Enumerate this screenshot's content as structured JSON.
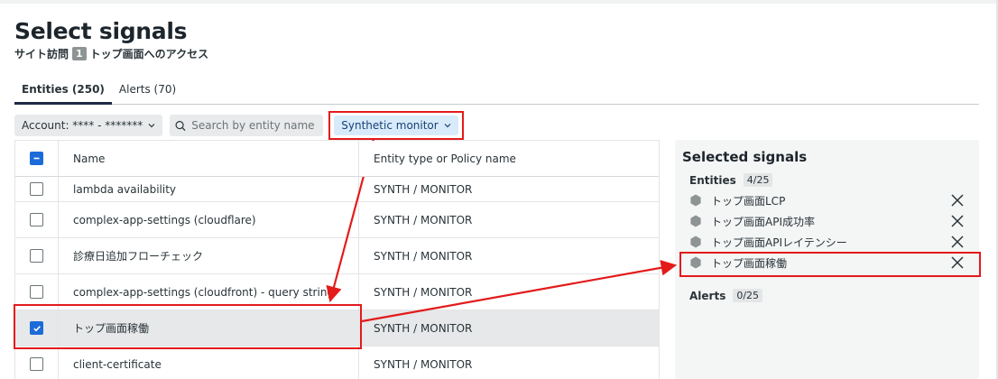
{
  "header": {
    "title": "Select signals",
    "subtitle_prefix": "サイト訪問",
    "subtitle_number": "1",
    "subtitle_suffix": "トップ画面へのアクセス"
  },
  "tabs": [
    {
      "label": "Entities (250)",
      "active": true
    },
    {
      "label": "Alerts (70)",
      "active": false
    }
  ],
  "filters": {
    "account_label": "Account: **** - *******",
    "search_placeholder": "Search by entity name",
    "synthetic_label": "Synthetic monitor"
  },
  "table": {
    "columns": [
      "Name",
      "Entity type or Policy name"
    ],
    "rows": [
      {
        "name": "lambda availability",
        "type": "SYNTH / MONITOR",
        "checked": false
      },
      {
        "name": "complex-app-settings (cloudflare)",
        "type": "SYNTH / MONITOR",
        "checked": false
      },
      {
        "name": "診療日追加フローチェック",
        "type": "SYNTH / MONITOR",
        "checked": false
      },
      {
        "name": "complex-app-settings (cloudfront) - query string",
        "type": "SYNTH / MONITOR",
        "checked": false
      },
      {
        "name": "トップ画面稼働",
        "type": "SYNTH / MONITOR",
        "checked": true
      },
      {
        "name": "client-certificate",
        "type": "SYNTH / MONITOR",
        "checked": false
      }
    ]
  },
  "selected_panel": {
    "title": "Selected signals",
    "entities_label": "Entities",
    "entities_count": "4/25",
    "entities": [
      "トップ画面LCP",
      "トップ画面API成功率",
      "トップ画面APIレイテンシー",
      "トップ画面稼働"
    ],
    "alerts_label": "Alerts",
    "alerts_count": "0/25"
  },
  "icons": {
    "search": "search-icon",
    "dropdown": "chevron-down-icon",
    "entity": "hexagon-icon",
    "remove": "close-icon"
  },
  "colors": {
    "accent": "#1d6bd8",
    "highlight": "#e31b1b",
    "filter_active_bg": "#d8ebfb"
  }
}
